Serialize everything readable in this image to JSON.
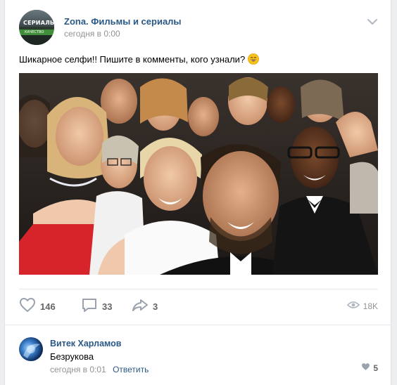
{
  "post": {
    "group_name": "Zona. Фильмы и сериалы",
    "time": "сегодня в 0:00",
    "text": "Шикарное селфи!! Пишите в комменты, кого узнали?",
    "avatar_text": "СЕРИАЛЫ",
    "avatar_subtext": "КАЧЕСТВО",
    "emoji": "smiling-face-icon"
  },
  "actions": {
    "likes": "146",
    "comments": "33",
    "shares": "3",
    "views": "18K"
  },
  "comment": {
    "author": "Витек Харламов",
    "text": "Безрукова",
    "time": "сегодня в 0:01",
    "reply_label": "Ответить",
    "likes": "5"
  },
  "colors": {
    "link": "#2a5885",
    "muted": "#939393",
    "icon": "#99a2ad",
    "background": "#edeef0"
  }
}
